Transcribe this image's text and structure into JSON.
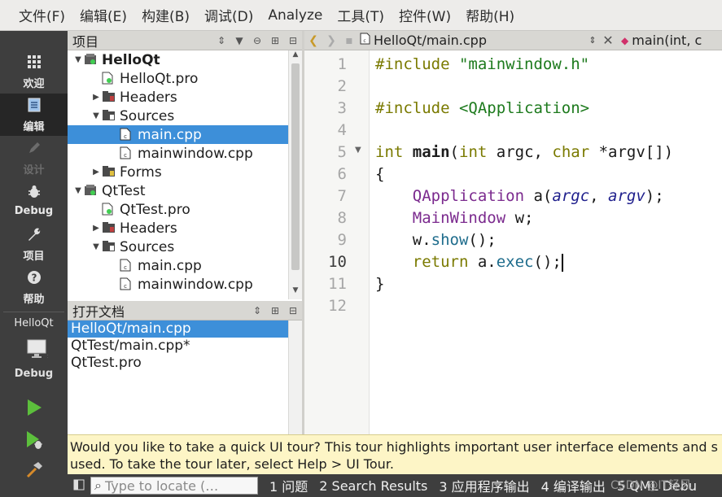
{
  "menubar": {
    "items": [
      "文件(F)",
      "编辑(E)",
      "构建(B)",
      "调试(D)",
      "Analyze",
      "工具(T)",
      "控件(W)",
      "帮助(H)"
    ]
  },
  "modebar": {
    "modes": [
      {
        "label": "欢迎",
        "icon": "grid-icon"
      },
      {
        "label": "编辑",
        "icon": "document-icon"
      },
      {
        "label": "设计",
        "icon": "pencil-icon"
      },
      {
        "label": "Debug",
        "icon": "bug-icon"
      },
      {
        "label": "项目",
        "icon": "wrench-icon"
      },
      {
        "label": "帮助",
        "icon": "help-icon"
      }
    ],
    "kit": {
      "project": "HelloQt",
      "mode": "Debug"
    }
  },
  "project_panel": {
    "title": "项目",
    "tree": [
      {
        "label": "HelloQt",
        "arrow": "▼",
        "icon": "project",
        "indent": 0,
        "bold": true
      },
      {
        "label": "HelloQt.pro",
        "arrow": "",
        "icon": "pro",
        "indent": 1
      },
      {
        "label": "Headers",
        "arrow": "▶",
        "icon": "folder-h",
        "indent": 1
      },
      {
        "label": "Sources",
        "arrow": "▼",
        "icon": "folder-cpp",
        "indent": 1
      },
      {
        "label": "main.cpp",
        "arrow": "",
        "icon": "cpp",
        "indent": 2,
        "selected": true
      },
      {
        "label": "mainwindow.cpp",
        "arrow": "",
        "icon": "cpp",
        "indent": 2
      },
      {
        "label": "Forms",
        "arrow": "▶",
        "icon": "folder-ui",
        "indent": 1
      },
      {
        "label": "QtTest",
        "arrow": "▼",
        "icon": "project",
        "indent": 0
      },
      {
        "label": "QtTest.pro",
        "arrow": "",
        "icon": "pro",
        "indent": 1
      },
      {
        "label": "Headers",
        "arrow": "▶",
        "icon": "folder-h",
        "indent": 1
      },
      {
        "label": "Sources",
        "arrow": "▼",
        "icon": "folder-cpp",
        "indent": 1
      },
      {
        "label": "main.cpp",
        "arrow": "",
        "icon": "cpp",
        "indent": 2
      },
      {
        "label": "mainwindow.cpp",
        "arrow": "",
        "icon": "cpp",
        "indent": 2
      }
    ]
  },
  "open_docs": {
    "title": "打开文档",
    "items": [
      "HelloQt/main.cpp",
      "QtTest/main.cpp*",
      "QtTest.pro"
    ],
    "selected_index": 0
  },
  "editor": {
    "file": "HelloQt/main.cpp",
    "symbol": "main(int, c",
    "current_line": 10,
    "line_numbers": [
      "1",
      "2",
      "3",
      "4",
      "5",
      "6",
      "7",
      "8",
      "9",
      "10",
      "11",
      "12"
    ]
  },
  "infobar": {
    "line1": "Would you like to take a quick UI tour? This tour highlights important user interface elements and s",
    "line2": "used. To take the tour later, select Help > UI Tour."
  },
  "statusbar": {
    "locator_placeholder": "Type to locate (…",
    "tabs": [
      "1 问题",
      "2 Search Results",
      "3 应用程序输出",
      "4 编译输出",
      "5 QML Debu"
    ],
    "watermark": "CSDN @IT轻风"
  },
  "colors": {
    "selection": "#3d8fd9",
    "modebar_bg": "#3e3e3e",
    "info_bg": "#fdf5c6",
    "keyword": "#7a7a00",
    "string": "#1d7a1d",
    "class": "#7b2a8e"
  }
}
